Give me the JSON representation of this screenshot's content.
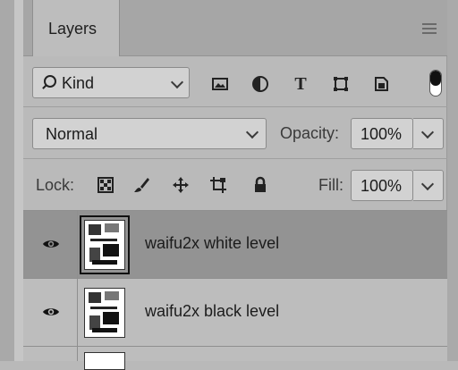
{
  "panel": {
    "tab_label": "Layers"
  },
  "filter": {
    "kind_label": "Kind"
  },
  "blend": {
    "mode": "Normal",
    "opacity_label": "Opacity:",
    "opacity_value": "100%"
  },
  "lock": {
    "label": "Lock:",
    "fill_label": "Fill:",
    "fill_value": "100%"
  },
  "layers": [
    {
      "name": "waifu2x white level",
      "selected": true
    },
    {
      "name": "waifu2x black level",
      "selected": false
    }
  ],
  "icons": [
    "search-icon",
    "image-filter-icon",
    "adjustment-filter-icon",
    "type-filter-icon",
    "shape-filter-icon",
    "smartobject-filter-icon",
    "lock-pixels-icon",
    "lock-paint-icon",
    "lock-move-icon",
    "lock-artboard-icon",
    "lock-all-icon",
    "eye-icon"
  ]
}
